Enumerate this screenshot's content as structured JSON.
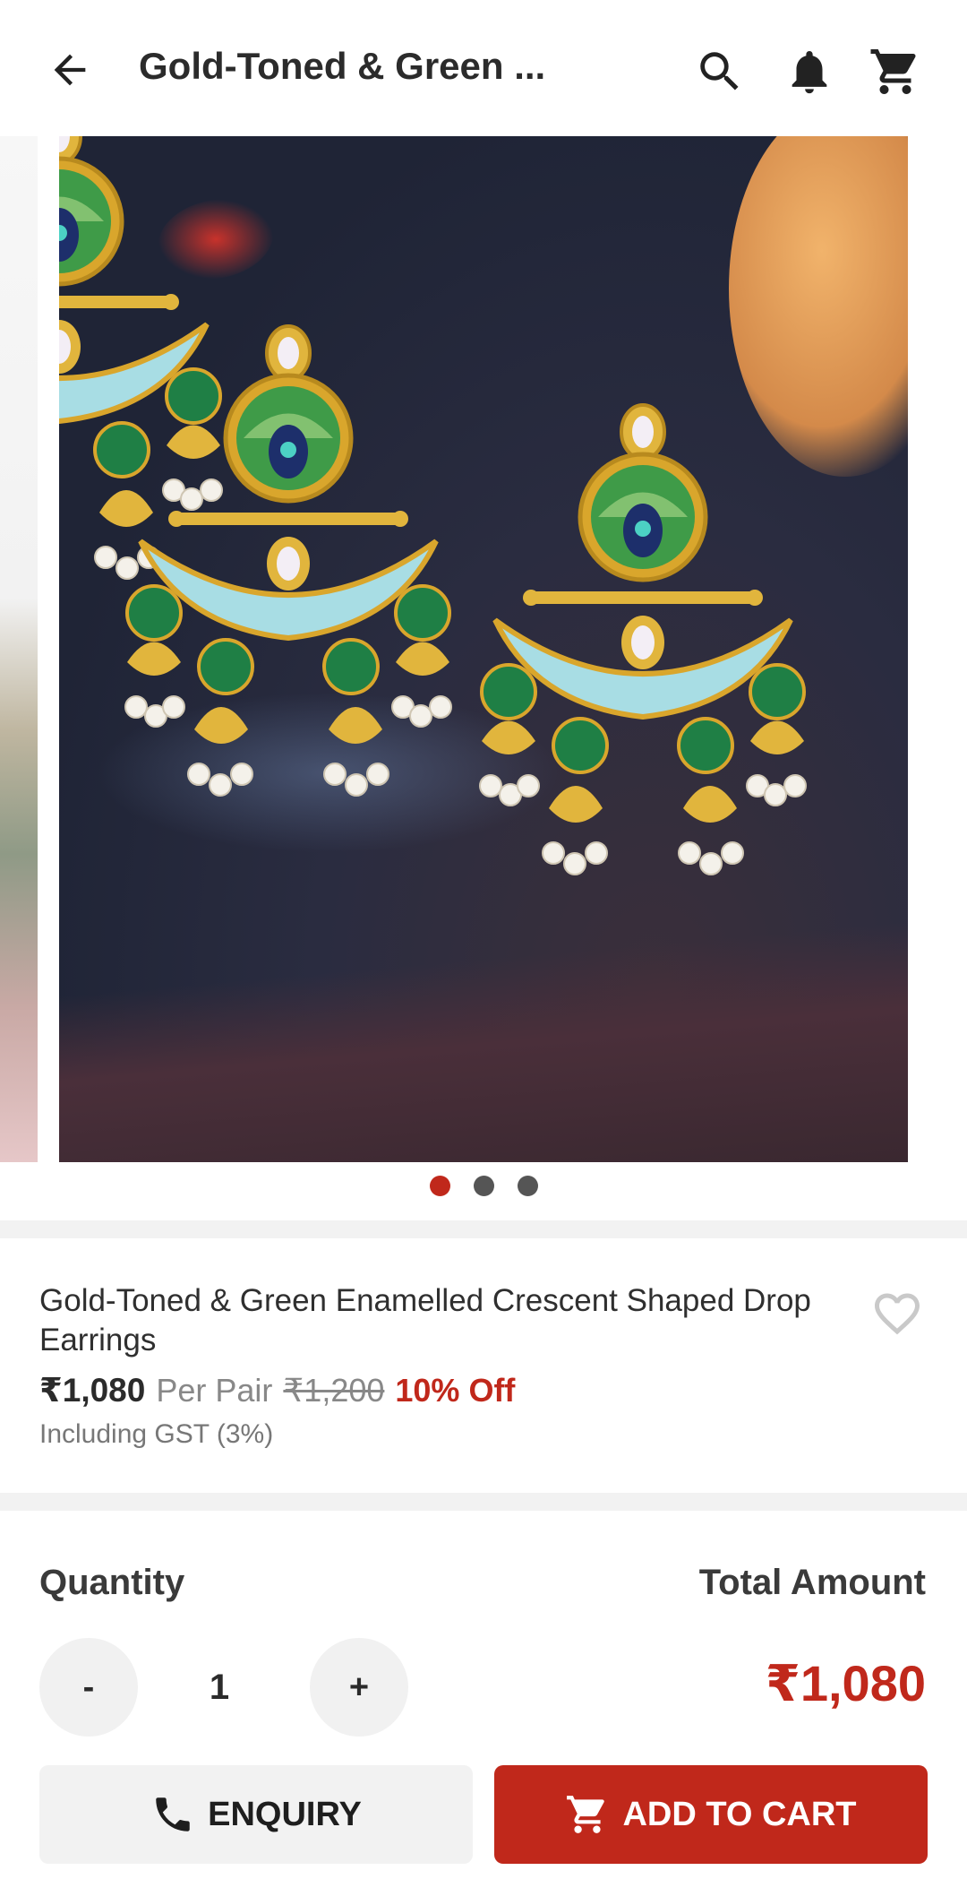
{
  "appbar": {
    "title": "Gold-Toned & Green ...",
    "back_icon": "arrow-left-icon",
    "actions": [
      "search-icon",
      "bell-icon",
      "cart-icon"
    ]
  },
  "carousel": {
    "image_alt": "Gold-Toned & Green Enamelled Crescent Shaped Drop Earrings",
    "image_count": 3,
    "active_index": 0
  },
  "product": {
    "name": "Gold-Toned & Green Enamelled Crescent Shaped Drop Earrings",
    "price": "₹1,080",
    "unit": "Per Pair",
    "mrp": "₹1,200",
    "discount": "10% Off",
    "gst": "Including GST (3%)",
    "wishlist_icon": "heart-outline-icon"
  },
  "order": {
    "quantity_label": "Quantity",
    "total_label": "Total Amount",
    "minus": "-",
    "plus": "+",
    "quantity": "1",
    "total": "₹1,080"
  },
  "actions": {
    "enquiry_label": "ENQUIRY",
    "enquiry_icon": "phone-icon",
    "add_to_cart_label": "ADD TO CART",
    "add_to_cart_icon": "cart-icon"
  },
  "colors": {
    "accent": "#c0281b",
    "text": "#2b2b2b",
    "muted": "#888888"
  }
}
